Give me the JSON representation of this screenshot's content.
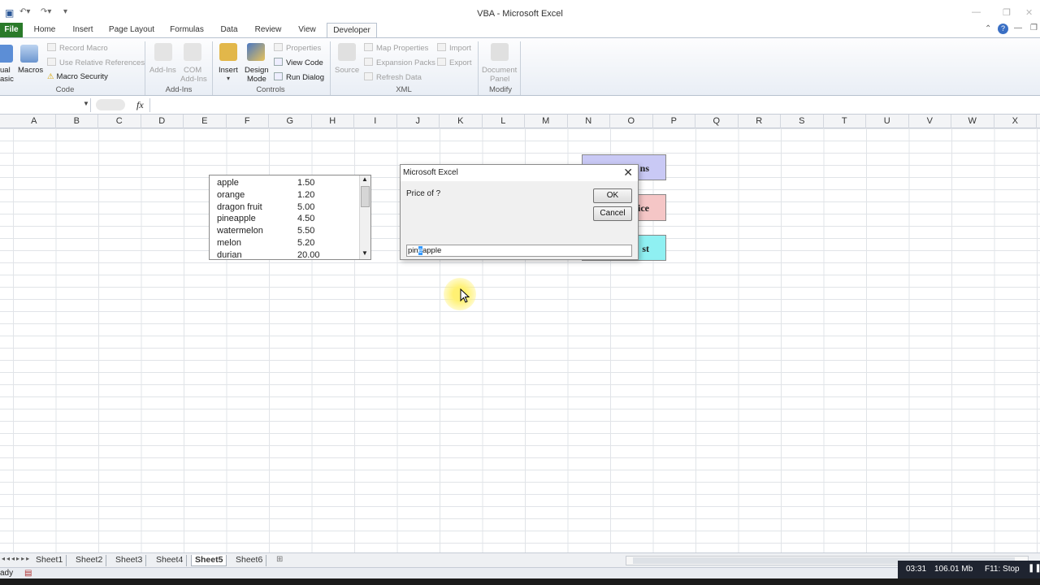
{
  "window": {
    "title": "VBA  -  Microsoft Excel"
  },
  "ribbon_tabs": [
    {
      "label": "File"
    },
    {
      "label": "Home"
    },
    {
      "label": "Insert"
    },
    {
      "label": "Page Layout"
    },
    {
      "label": "Formulas"
    },
    {
      "label": "Data"
    },
    {
      "label": "Review"
    },
    {
      "label": "View"
    },
    {
      "label": "Developer"
    }
  ],
  "ribbon": {
    "visual_basic": "ual\nasic",
    "macros": "Macros",
    "record_macro": "Record Macro",
    "use_relative": "Use Relative References",
    "macro_security": "Macro Security",
    "group_code": "Code",
    "add_ins": "Add-Ins",
    "com_add_ins_1": "COM",
    "com_add_ins_2": "Add-Ins",
    "group_add_ins": "Add-Ins",
    "insert": "Insert",
    "design_mode_1": "Design",
    "design_mode_2": "Mode",
    "properties": "Properties",
    "view_code": "View Code",
    "run_dialog": "Run Dialog",
    "group_controls": "Controls",
    "source": "Source",
    "map_properties": "Map Properties",
    "expansion_packs": "Expansion Packs",
    "refresh_data": "Refresh Data",
    "import": "Import",
    "export": "Export",
    "group_xml": "XML",
    "document_panel_1": "Document",
    "document_panel_2": "Panel",
    "group_modify": "Modify"
  },
  "formula_bar": {
    "fx": "fx"
  },
  "columns": [
    "A",
    "B",
    "C",
    "D",
    "E",
    "F",
    "G",
    "H",
    "I",
    "J",
    "K",
    "L",
    "M",
    "N",
    "O",
    "P",
    "Q",
    "R",
    "S",
    "T",
    "U",
    "V",
    "W",
    "X"
  ],
  "listbox": {
    "rows": [
      {
        "name": "apple",
        "value": "1.50"
      },
      {
        "name": "orange",
        "value": "1.20"
      },
      {
        "name": "dragon fruit",
        "value": "5.00"
      },
      {
        "name": "pineapple",
        "value": "4.50"
      },
      {
        "name": "watermelon",
        "value": "5.50"
      },
      {
        "name": "melon",
        "value": "5.20"
      },
      {
        "name": "durian",
        "value": "20.00"
      }
    ]
  },
  "shapes": [
    {
      "text": "ns",
      "color": "#c9c9f5"
    },
    {
      "text": "ice",
      "color": "#f5c6c6"
    },
    {
      "text": "st",
      "color": "#8ff0f2"
    }
  ],
  "dialog": {
    "title": "Microsoft Excel",
    "prompt": "Price of ?",
    "ok": "OK",
    "cancel": "Cancel",
    "input_before": "pin",
    "input_selected": "e",
    "input_after": "apple"
  },
  "sheet_tabs": [
    {
      "label": "Sheet1"
    },
    {
      "label": "Sheet2"
    },
    {
      "label": "Sheet3"
    },
    {
      "label": "Sheet4"
    },
    {
      "label": "Sheet5"
    },
    {
      "label": "Sheet6"
    }
  ],
  "status": {
    "left_text": "ady",
    "time": "03:31",
    "size": "106.01 Mb",
    "hint": "F11: Stop"
  }
}
